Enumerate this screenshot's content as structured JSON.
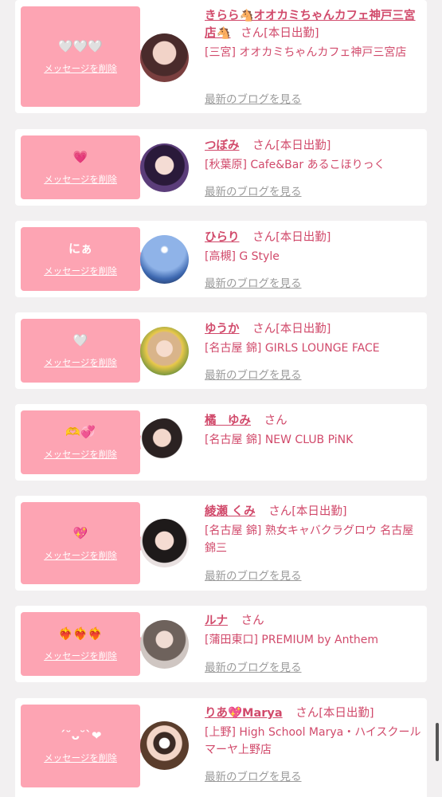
{
  "delete_label": "メッセージを削除",
  "blog_label": "最新のブログを見る",
  "san_label": "さん",
  "items": [
    {
      "message": "🤍🤍🤍",
      "name": "きらら🐴オオカミちゃんカフェ神戸三宮店🐴",
      "status": "[本日出勤]",
      "shop": "[三宮] オオカミちゃんカフェ神戸三宮店"
    },
    {
      "message": "💗",
      "name": "つぼみ",
      "status": "[本日出勤]",
      "shop": "[秋葉原] Cafe&Bar あるこほりっく"
    },
    {
      "message": "にぁ",
      "name": "ひらり",
      "status": "[本日出勤]",
      "shop": "[高槻] G Style"
    },
    {
      "message": "🤍",
      "name": "ゆうか",
      "status": "[本日出勤]",
      "shop": "[名古屋 錦] GIRLS LOUNGE FACE"
    },
    {
      "message": "🫶💞",
      "name": "橘　ゆみ",
      "status": "",
      "shop": "[名古屋 錦] NEW CLUB PiNK"
    },
    {
      "message": "💖",
      "name": "綾瀬 くみ",
      "status": "[本日出勤]",
      "shop": "[名古屋 錦] 熟女キャバクラグロウ 名古屋錦三"
    },
    {
      "message": "❤️‍🔥❤️‍🔥❤️‍🔥",
      "name": "ルナ",
      "status": "",
      "shop": "[蒲田東口] PREMIUM by Anthem"
    },
    {
      "message": "ˊ˘ᴗ˘ˋ❤",
      "name": "りあ💖Marya",
      "status": "[本日出勤]",
      "shop": "[上野] High School Marya・ハイスクールマーヤ上野店"
    }
  ],
  "colors": {
    "accent": "#d14a6b",
    "bubble": "#fda4b3",
    "muted": "#9b9b9b",
    "background": "#f2f0f1"
  }
}
